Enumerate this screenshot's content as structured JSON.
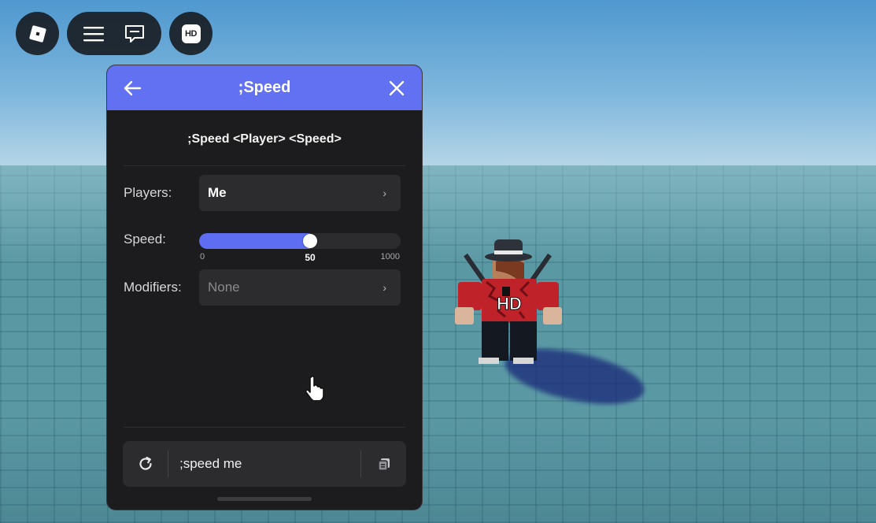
{
  "topbar": {
    "roblox_icon": "roblox-logo-icon",
    "menu_icon": "hamburger-menu-icon",
    "chat_icon": "chat-icon",
    "hd_badge": "HD"
  },
  "panel": {
    "title": ";Speed",
    "back_icon": "arrow-left-icon",
    "close_icon": "close-icon",
    "syntax": ";Speed <Player> <Speed>",
    "players": {
      "label": "Players:",
      "value": "Me"
    },
    "speed": {
      "label": "Speed:",
      "min": "0",
      "current": "50",
      "max": "1000",
      "fill_fraction": 0.55
    },
    "modifiers": {
      "label": "Modifiers:",
      "value": "None"
    },
    "command": {
      "refresh_icon": "refresh-icon",
      "text": ";speed me",
      "copy_icon": "copy-icon"
    }
  },
  "colors": {
    "accent": "#6271f2",
    "panel_bg": "#1c1c1e",
    "field_bg": "#2c2c2f"
  }
}
